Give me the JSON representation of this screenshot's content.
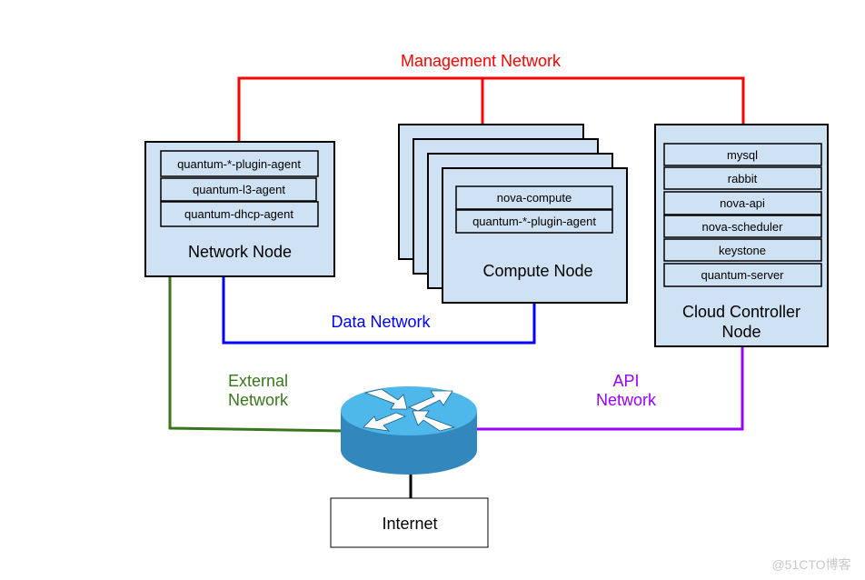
{
  "colors": {
    "management": "#ff0000",
    "data": "#0000ff",
    "external": "#38761d",
    "api": "#9900ff",
    "node_fill": "#cfe2f3",
    "router": "#3d9ad0"
  },
  "networks": {
    "management": "Management Network",
    "data": "Data Network",
    "external": [
      "External",
      "Network"
    ],
    "api": [
      "API",
      "Network"
    ]
  },
  "network_node": {
    "label": "Network Node",
    "services": [
      "quantum-*-plugin-agent",
      "quantum-l3-agent",
      "quantum-dhcp-agent"
    ]
  },
  "compute_node": {
    "label": "Compute Node",
    "services": [
      "nova-compute",
      "quantum-*-plugin-agent"
    ]
  },
  "controller_node": {
    "label": [
      "Cloud Controller",
      "Node"
    ],
    "services": [
      "mysql",
      "rabbit",
      "nova-api",
      "nova-scheduler",
      "keystone",
      "quantum-server"
    ]
  },
  "router": {
    "icon": "router-icon"
  },
  "internet": {
    "label": "Internet"
  },
  "watermark": "@51CTO博客"
}
